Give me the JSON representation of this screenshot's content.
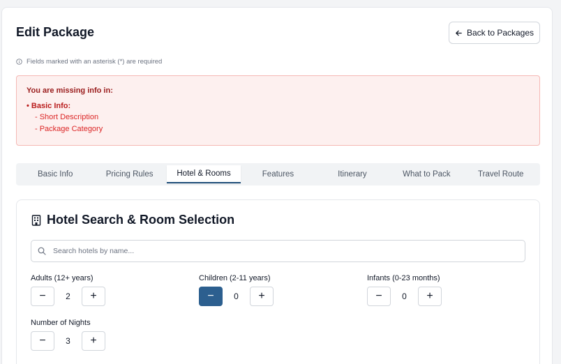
{
  "header": {
    "title": "Edit Package",
    "back_label": "Back to Packages"
  },
  "required_note": "Fields marked with an asterisk (*) are required",
  "alert": {
    "title": "You are missing info in:",
    "section": "• Basic Info:",
    "fields": [
      "- Short Description",
      "- Package Category"
    ]
  },
  "tabs": [
    {
      "label": "Basic Info",
      "active": false
    },
    {
      "label": "Pricing Rules",
      "active": false
    },
    {
      "label": "Hotel & Rooms",
      "active": true
    },
    {
      "label": "Features",
      "active": false
    },
    {
      "label": "Itinerary",
      "active": false
    },
    {
      "label": "What to Pack",
      "active": false
    },
    {
      "label": "Travel Route",
      "active": false
    }
  ],
  "hotel_section": {
    "title": "Hotel Search & Room Selection",
    "search_placeholder": "Search hotels by name...",
    "adults": {
      "label": "Adults (12+ years)",
      "value": "2"
    },
    "children": {
      "label": "Children (2-11 years)",
      "value": "0"
    },
    "infants": {
      "label": "Infants (0-23 months)",
      "value": "0"
    },
    "nights": {
      "label": "Number of Nights",
      "value": "3"
    }
  },
  "colors": {
    "accent": "#2c5f8f",
    "alert_bg": "#fdf0ef",
    "alert_text": "#b91c1c"
  },
  "icons": {
    "back": "arrow-left-icon",
    "info": "info-icon",
    "hotel": "building-icon",
    "search": "search-icon",
    "minus": "minus-icon",
    "plus": "plus-icon"
  }
}
